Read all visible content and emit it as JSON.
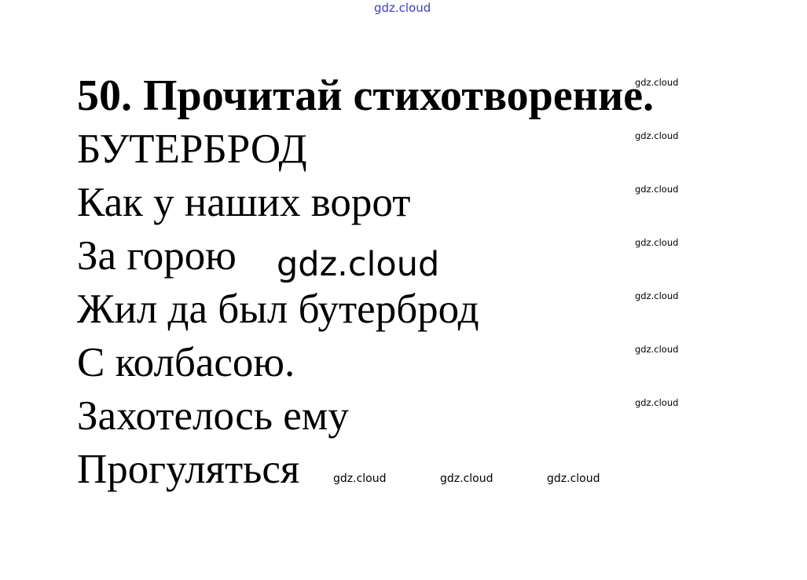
{
  "header": {
    "watermark": "gdz.cloud"
  },
  "task": {
    "title": "50. Прочитай стихотворение."
  },
  "poem": {
    "title": "БУТЕРБРОД",
    "lines": [
      "Как у наших ворот",
      "За горою",
      "Жил да был бутерброд",
      "С колбасою.",
      "Захотелось ему",
      "Прогуляться"
    ]
  },
  "watermarks": {
    "right_column": [
      "gdz.cloud",
      "gdz.cloud",
      "gdz.cloud",
      "gdz.cloud",
      "gdz.cloud",
      "gdz.cloud",
      "gdz.cloud"
    ],
    "center_large": "gdz.cloud",
    "bottom_row": [
      "gdz.cloud",
      "gdz.cloud",
      "gdz.cloud"
    ]
  },
  "colors": {
    "text": "#000000",
    "header_watermark": "#3b3bd6",
    "background": "#ffffff"
  }
}
